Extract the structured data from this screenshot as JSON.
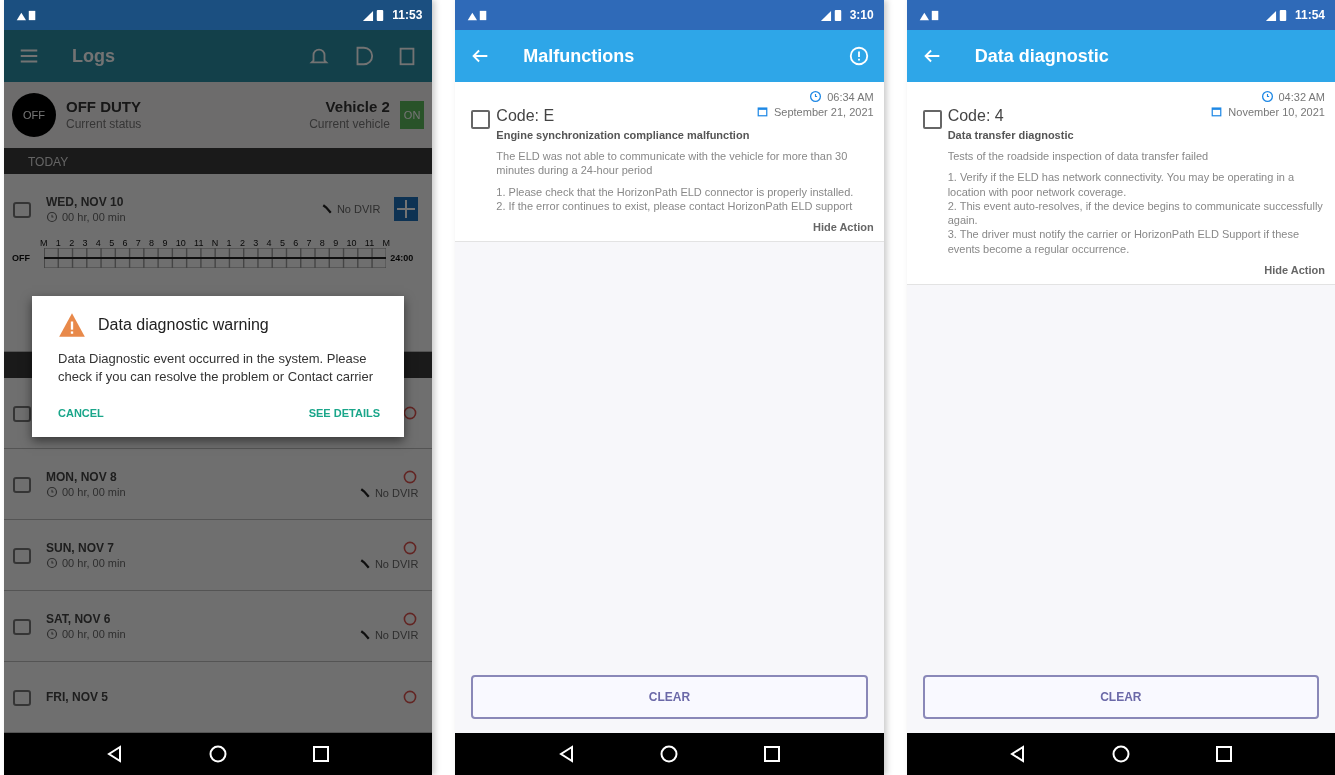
{
  "phones": [
    {
      "kind": "logs",
      "status_time": "11:53",
      "title": "Logs",
      "driver": {
        "avatar": "OFF",
        "status": "OFF DUTY",
        "status_caption": "Current status",
        "vehicle": "Vehicle 2",
        "vehicle_caption": "Current vehicle",
        "badge": "ON"
      },
      "section": "TODAY",
      "chart": {
        "hours": [
          "M",
          "1",
          "2",
          "3",
          "4",
          "5",
          "6",
          "7",
          "8",
          "9",
          "10",
          "11",
          "N",
          "1",
          "2",
          "3",
          "4",
          "5",
          "6",
          "7",
          "8",
          "9",
          "10",
          "11",
          "M"
        ],
        "row_label": "OFF",
        "total": "24:00"
      },
      "rows": [
        {
          "day": "WED, NOV 10",
          "duration": "00 hr, 00 min",
          "dvir": "No DVIR",
          "violation": false,
          "chart": true
        },
        {
          "violation": true,
          "chart": false
        },
        {
          "day": "MON, NOV 8",
          "duration": "00 hr, 00 min",
          "dvir": "No DVIR",
          "violation": true,
          "chart": false
        },
        {
          "day": "SUN, NOV 7",
          "duration": "00 hr, 00 min",
          "dvir": "No DVIR",
          "violation": true,
          "chart": false
        },
        {
          "day": "SAT, NOV 6",
          "duration": "00 hr, 00 min",
          "dvir": "No DVIR",
          "violation": true,
          "chart": false
        },
        {
          "day": "FRI, NOV 5",
          "violation": true,
          "chart": false
        }
      ],
      "dialog": {
        "title": "Data diagnostic warning",
        "message": "Data Diagnostic event occurred in the system. Please check if you can resolve the problem or Contact carrier",
        "buttons": [
          "CANCEL",
          "SEE DETAILS"
        ]
      }
    },
    {
      "kind": "events",
      "status_time": "3:10",
      "title": "Malfunctions",
      "info_button": true,
      "event": {
        "checked": false,
        "code": "Code: E",
        "time": "06:34 AM",
        "date": "September 21, 2021",
        "name": "Engine synchronization compliance malfunction",
        "description": "The ELD was not able to communicate with the vehicle for more than 30 minutes during a 24-hour period",
        "steps": [
          "1. Please check that the HorizonPath ELD connector is properly installed.",
          "2. If the error continues to exist, please contact HorizonPath ELD support"
        ],
        "toggle": "Hide Action"
      },
      "button": "CLEAR"
    },
    {
      "kind": "events",
      "status_time": "11:54",
      "title": "Data diagnostic",
      "info_button": false,
      "event": {
        "checked": false,
        "code": "Code: 4",
        "time": "04:32 AM",
        "date": "November 10, 2021",
        "name": "Data transfer diagnostic",
        "description": "Tests of the roadside inspection of data transfer failed",
        "steps": [
          "1. Verify if the ELD has network connectivity. You may be operating in a location with poor network coverage.",
          "2. This event auto-resolves, if the device begins to communicate successfully again.",
          "3. The driver must notify the carrier or HorizonPath ELD Support if these events become a regular occurrence."
        ],
        "toggle": "Hide Action"
      },
      "button": "CLEAR"
    }
  ]
}
